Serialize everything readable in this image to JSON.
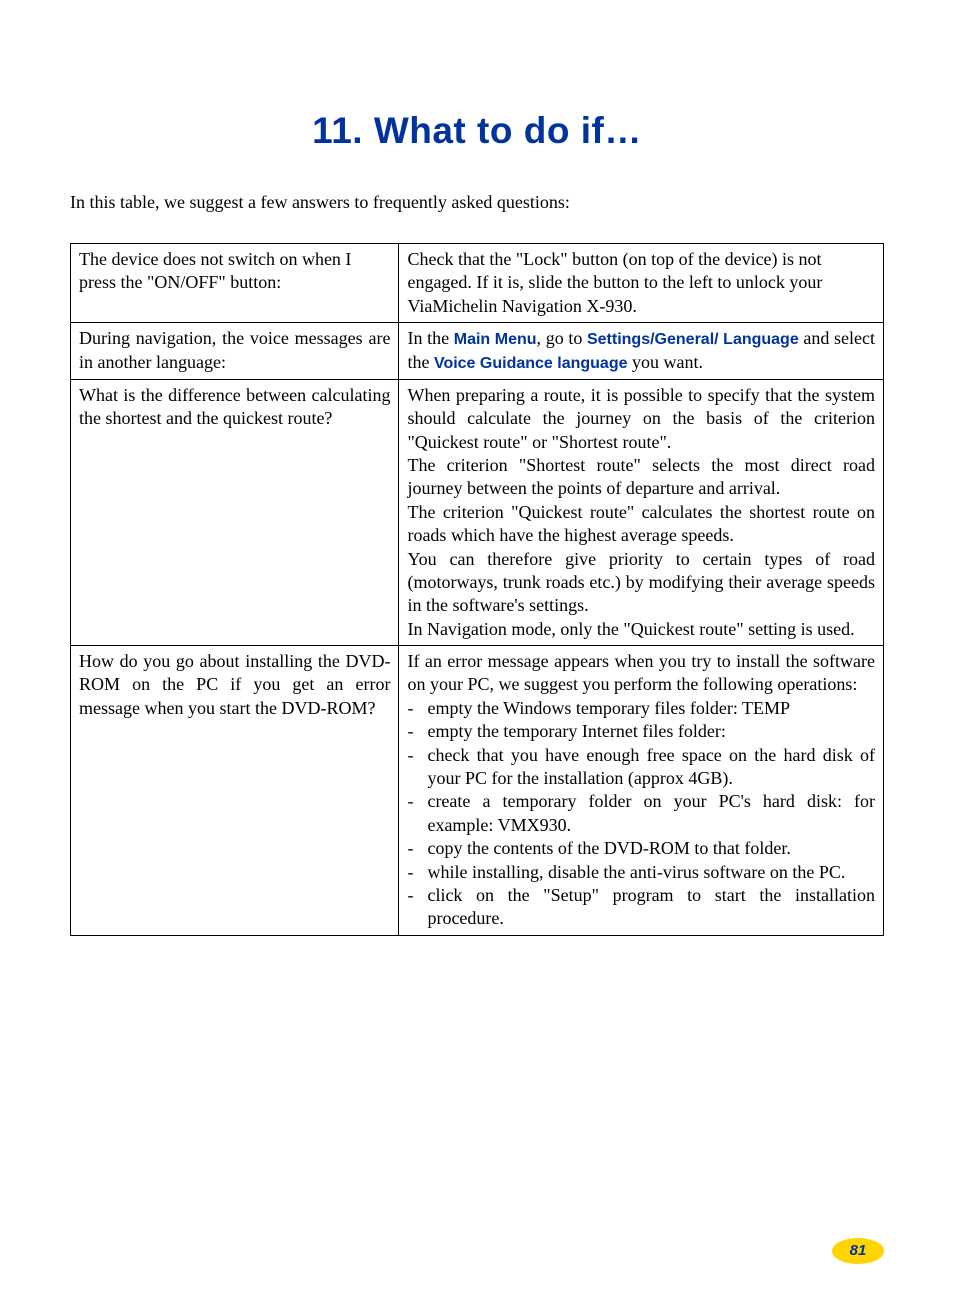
{
  "title": "11. What to do if…",
  "intro": "In this table, we suggest a few answers to frequently asked questions:",
  "rows": [
    {
      "q": "The device does not switch on when I press the \"ON/OFF\" button:",
      "a": {
        "type": "plain",
        "text": "Check that the \"Lock\" button (on top of the device) is not engaged. If it is, slide the button to the left to unlock your ViaMichelin Navigation X-930."
      }
    },
    {
      "q": "During navigation, the voice messages are in another language:",
      "a": {
        "type": "rich",
        "parts": [
          {
            "t": "In the "
          },
          {
            "t": "Main Menu",
            "blue": true
          },
          {
            "t": ", go to "
          },
          {
            "t": "Settings/General/ Language",
            "blue": true
          },
          {
            "t": " and select the "
          },
          {
            "t": "Voice Guidance language",
            "blue": true
          },
          {
            "t": " you want."
          }
        ]
      }
    },
    {
      "q": "What is the difference between calculating the shortest and the quickest route?",
      "a": {
        "type": "paras",
        "paras": [
          "When preparing a route, it is possible to specify that the system should calculate the journey on the basis of the criterion \"Quickest route\" or \"Shortest route\".",
          "The criterion \"Shortest route\" selects the most direct road journey between the points of departure and arrival.",
          "The criterion \"Quickest route\" calculates the shortest route on roads which have the highest average speeds.",
          "You can therefore give priority to certain types of road (motorways, trunk roads etc.) by modifying their average speeds in the software's settings.",
          "In Navigation mode, only the \"Quickest route\" setting is used."
        ]
      }
    },
    {
      "q": "How do you go about installing the DVD-ROM on the PC if you get an error message when you start the DVD-ROM?",
      "a": {
        "type": "list",
        "lead": "If an error message appears when you try to install the software on your PC, we suggest you perform the following operations:",
        "items": [
          "empty the Windows temporary files folder: TEMP",
          "empty the temporary Internet files folder:",
          "check that you have enough free space on the hard disk of your PC for the installation (approx 4GB).",
          "create a temporary folder on your PC's hard disk: for example: VMX930.",
          "copy the contents of the DVD-ROM to that folder.",
          "while installing, disable the anti-virus software on the PC.",
          "click on the \"Setup\" program to start the installation procedure."
        ]
      }
    }
  ],
  "pageNumber": "81"
}
